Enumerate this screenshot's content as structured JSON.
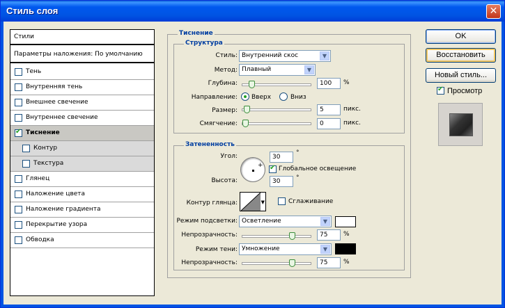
{
  "window": {
    "title": "Стиль слоя",
    "close_glyph": "✕"
  },
  "styles": {
    "header": "Стили",
    "blending": "Параметры наложения: По умолчанию",
    "items": [
      {
        "label": "Тень",
        "checked": false
      },
      {
        "label": "Внутренняя тень",
        "checked": false
      },
      {
        "label": "Внешнее свечение",
        "checked": false
      },
      {
        "label": "Внутреннее свечение",
        "checked": false
      },
      {
        "label": "Тиснение",
        "checked": true
      },
      {
        "label": "Контур",
        "checked": false
      },
      {
        "label": "Текстура",
        "checked": false
      },
      {
        "label": "Глянец",
        "checked": false
      },
      {
        "label": "Наложение цвета",
        "checked": false
      },
      {
        "label": "Наложение градиента",
        "checked": false
      },
      {
        "label": "Перекрытие узора",
        "checked": false
      },
      {
        "label": "Обводка",
        "checked": false
      }
    ]
  },
  "bevel": {
    "section_title": "Тиснение",
    "structure": {
      "title": "Структура",
      "style_label": "Стиль:",
      "style_value": "Внутренний скос",
      "method_label": "Метод:",
      "method_value": "Плавный",
      "depth_label": "Глубина:",
      "depth_value": "100",
      "depth_unit": "%",
      "depth_level": 0.1,
      "direction_label": "Направление:",
      "up_label": "Вверх",
      "down_label": "Вниз",
      "direction_selected": "up",
      "size_label": "Размер:",
      "size_value": "5",
      "size_unit": "пикс.",
      "size_level": 0.02,
      "soften_label": "Смягчение:",
      "soften_value": "0",
      "soften_unit": "пикс.",
      "soften_level": 0.0
    },
    "shading": {
      "title": "Затененность",
      "angle_label": "Угол:",
      "angle_value": "30",
      "degree": "°",
      "global_light_label": "Глобальное освещение",
      "global_light_checked": true,
      "altitude_label": "Высота:",
      "altitude_value": "30",
      "gloss_contour_label": "Контур глянца:",
      "antialias_label": "Сглаживание",
      "antialias_checked": false,
      "highlight_mode_label": "Режим подсветки:",
      "highlight_mode_value": "Осветление",
      "highlight_color": "#ffffff",
      "highlight_opacity_label": "Непрозрачность:",
      "highlight_opacity_value": "75",
      "highlight_opacity_level": 0.75,
      "shadow_mode_label": "Режим тени:",
      "shadow_mode_value": "Умножение",
      "shadow_color": "#000000",
      "shadow_opacity_label": "Непрозрачность:",
      "shadow_opacity_value": "75",
      "shadow_opacity_level": 0.75,
      "percent": "%"
    }
  },
  "buttons": {
    "ok": "OK",
    "reset": "Восстановить",
    "new_style": "Новый стиль...",
    "preview_label": "Просмотр",
    "preview_checked": true
  }
}
